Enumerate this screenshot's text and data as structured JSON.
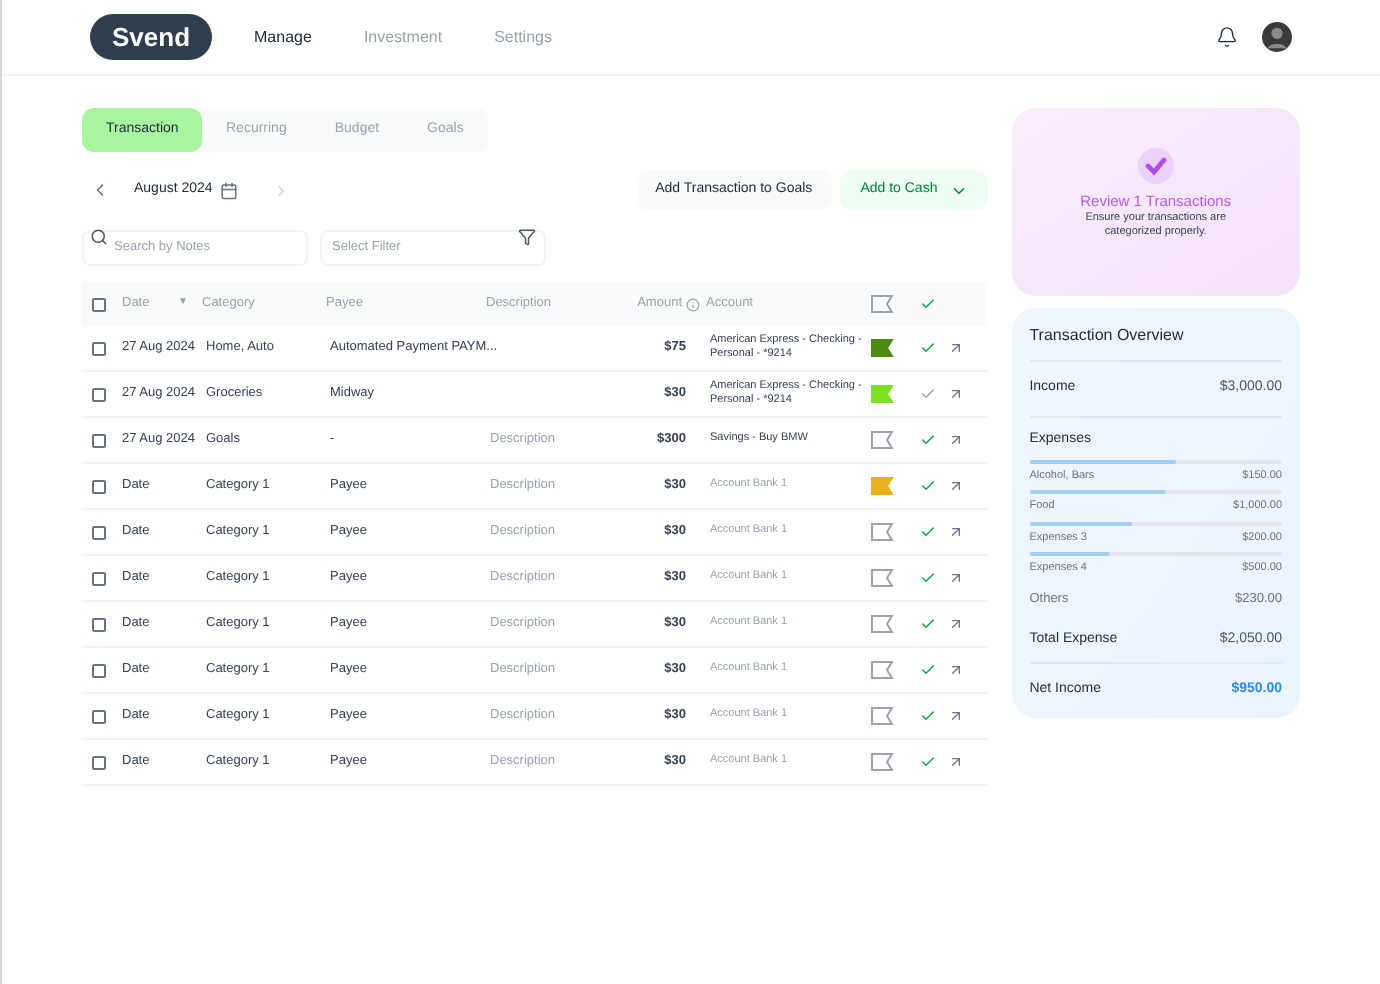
{
  "nav": {
    "logo": "Svend",
    "links": [
      {
        "label": "Manage",
        "selected": true
      },
      {
        "label": "Investment",
        "selected": false
      },
      {
        "label": "Settings",
        "selected": false
      }
    ]
  },
  "tabs": [
    {
      "label": "Transaction",
      "selected": true
    },
    {
      "label": "Recurring",
      "selected": false
    },
    {
      "label": "Budget",
      "selected": false
    },
    {
      "label": "Goals",
      "selected": false
    }
  ],
  "month": "August 2024",
  "actions": {
    "goals_button": "Add Transaction to Goals",
    "cash_button": "Add to Cash"
  },
  "search": {
    "placeholder": "Search by Notes"
  },
  "filter": {
    "placeholder": "Select Filter"
  },
  "table": {
    "select_all_checked": false,
    "sort_indicator": "▼",
    "columns": [
      "Date",
      "Category",
      "Payee",
      "Description",
      "Amount",
      "Account"
    ],
    "rows": [
      {
        "checked": false,
        "date": "27 Aug 2024",
        "category": "Home, Auto",
        "payee": "Automated Payment PAYM...",
        "description": "",
        "amount": "$75",
        "account": "American Express - Checking - Personal - *9214",
        "muted": false,
        "flagged": true,
        "color": "#4d8c14",
        "reviewed": true
      },
      {
        "checked": false,
        "date": "27 Aug 2024",
        "category": "Groceries",
        "payee": "Midway",
        "description": "",
        "amount": "$30",
        "account": "American Express - Checking - Personal - *9214",
        "muted": false,
        "flagged": true,
        "color": "#7ee01e",
        "reviewed": false
      },
      {
        "checked": false,
        "date": "27 Aug 2024",
        "category": "Goals",
        "payee": "-",
        "description": "Description",
        "amount": "$300",
        "account": "Savings - Buy BMW",
        "muted": false,
        "flagged": false,
        "reviewed": true
      },
      {
        "checked": false,
        "date": "Date",
        "category": "Category 1",
        "payee": "Payee",
        "description": "Description",
        "amount": "$30",
        "account": "Account Bank 1",
        "muted": true,
        "flagged": true,
        "color": "#e8b01a",
        "reviewed": true
      },
      {
        "checked": false,
        "date": "Date",
        "category": "Category 1",
        "payee": "Payee",
        "description": "Description",
        "amount": "$30",
        "account": "Account Bank 1",
        "muted": true,
        "flagged": false,
        "reviewed": true
      },
      {
        "checked": false,
        "date": "Date",
        "category": "Category 1",
        "payee": "Payee",
        "description": "Description",
        "amount": "$30",
        "account": "Account Bank 1",
        "muted": true,
        "flagged": false,
        "reviewed": true
      },
      {
        "checked": false,
        "date": "Date",
        "category": "Category 1",
        "payee": "Payee",
        "description": "Description",
        "amount": "$30",
        "account": "Account Bank 1",
        "muted": true,
        "flagged": false,
        "reviewed": true
      },
      {
        "checked": false,
        "date": "Date",
        "category": "Category 1",
        "payee": "Payee",
        "description": "Description",
        "amount": "$30",
        "account": "Account Bank 1",
        "muted": true,
        "flagged": false,
        "reviewed": true
      },
      {
        "checked": false,
        "date": "Date",
        "category": "Category 1",
        "payee": "Payee",
        "description": "Description",
        "amount": "$30",
        "account": "Account Bank 1",
        "muted": true,
        "flagged": false,
        "reviewed": true
      },
      {
        "checked": false,
        "date": "Date",
        "category": "Category 1",
        "payee": "Payee",
        "description": "Description",
        "amount": "$30",
        "account": "Account Bank 1",
        "muted": true,
        "flagged": false,
        "reviewed": true
      }
    ]
  },
  "review": {
    "title": "Review 1 Transactions",
    "text": "Ensure your transactions are categorized properly."
  },
  "overview": {
    "title": "Transaction Overview",
    "income_label": "Income",
    "income": "$3,000.00",
    "expenses_label": "Expenses",
    "expenses": [
      {
        "name": "Alcohol, Bars",
        "amount": "$150.00",
        "level": 0.58
      },
      {
        "name": "Food",
        "amount": "$1,000.00",
        "level": 0.54
      },
      {
        "name": "Expenses 3",
        "amount": "$200.00",
        "level": 0.41
      },
      {
        "name": "Expenses 4",
        "amount": "$500.00",
        "level": 0.32
      }
    ],
    "others_label": "Others",
    "others": "$230.00",
    "total_label": "Total Expense",
    "total": "$2,050.00",
    "net_label": "Net Income",
    "net": "$950.00"
  }
}
